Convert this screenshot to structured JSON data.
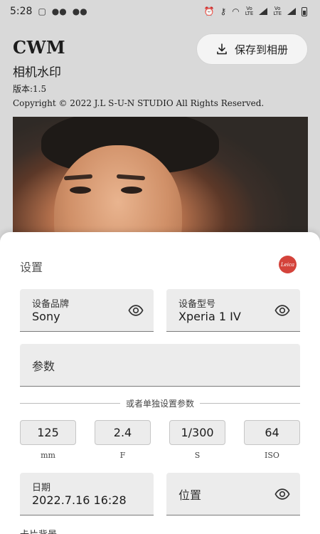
{
  "status_bar": {
    "time": "5:28",
    "left_icons": [
      "sim-icon",
      "wechat-icon",
      "wechat-icon"
    ],
    "right_icons": [
      "alarm-icon",
      "key-icon",
      "wifi-icon",
      "volte-icon",
      "signal-icon",
      "volte-icon",
      "signal-icon",
      "battery-icon"
    ],
    "lte_label": "LTE"
  },
  "header": {
    "title": "CWM",
    "subtitle": "相机水印",
    "version": "版本:1.5",
    "copyright": "Copyright © 2022 J.L S-U-N STUDIO All Rights Reserved."
  },
  "save_button": {
    "label": "保存到相册",
    "icon": "download-icon"
  },
  "settings": {
    "title": "设置",
    "logo_text": "Leica",
    "logo_color": "#d4433b",
    "brand": {
      "label": "设备品牌",
      "value": "Sony"
    },
    "model": {
      "label": "设备型号",
      "value": "Xperia 1 IV"
    },
    "params": {
      "placeholder": "参数"
    },
    "divider_text": "或者单独设置参数",
    "individual": [
      {
        "value": "125",
        "unit": "mm"
      },
      {
        "value": "2.4",
        "unit": "F"
      },
      {
        "value": "1/300",
        "unit": "S"
      },
      {
        "value": "64",
        "unit": "ISO"
      }
    ],
    "date": {
      "label": "日期",
      "value": "2022.7.16 16:28"
    },
    "location": {
      "placeholder": "位置"
    },
    "cut_off_label": "卡片背景"
  }
}
